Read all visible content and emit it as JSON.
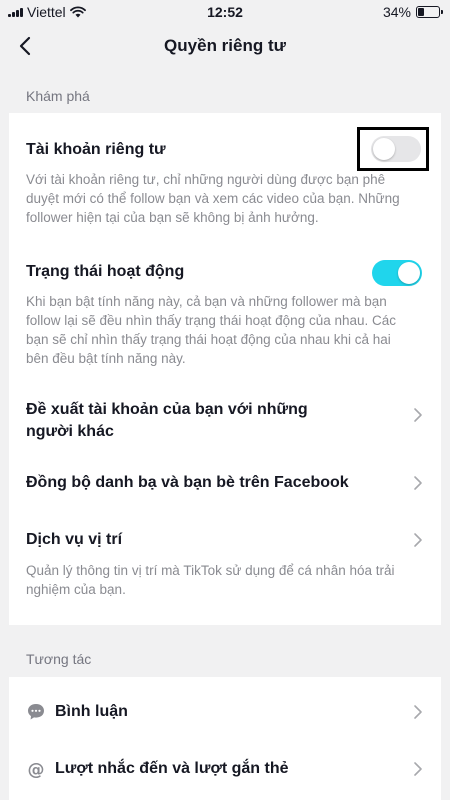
{
  "status_bar": {
    "carrier": "Viettel",
    "time": "12:52",
    "battery": "34%"
  },
  "nav": {
    "title": "Quyền riêng tư"
  },
  "discover": {
    "label": "Khám phá",
    "private_account": {
      "title": "Tài khoản riêng tư",
      "desc": "Với tài khoản riêng tư, chỉ những người dùng được bạn phê duyệt mới có thể follow bạn và xem các video của bạn. Những follower hiện tại của bạn sẽ không bị ảnh hưởng.",
      "enabled": false
    },
    "activity_status": {
      "title": "Trạng thái hoạt động",
      "desc": "Khi bạn bật tính năng này, cả bạn và những follower mà bạn follow lại sẽ đều nhìn thấy trạng thái hoạt động của nhau. Các bạn sẽ chỉ nhìn thấy trạng thái hoạt động của nhau khi cả hai bên đều bật tính năng này.",
      "enabled": true
    },
    "suggest_account": {
      "title": "Đề xuất tài khoản của bạn với những người khác"
    },
    "sync_contacts": {
      "title": "Đồng bộ danh bạ và bạn bè trên Facebook"
    },
    "location_services": {
      "title": "Dịch vụ vị trí",
      "desc": "Quản lý thông tin vị trí mà TikTok sử dụng để cá nhân hóa trải nghiệm của bạn."
    }
  },
  "interactions": {
    "label": "Tương tác",
    "comments": {
      "title": "Bình luận",
      "icon": "comment-icon"
    },
    "mentions": {
      "title": "Lượt nhắc đến và lượt gắn thẻ",
      "icon": "at-icon"
    }
  },
  "colors": {
    "toggle_on": "#20d5ec",
    "highlight": "#000000"
  }
}
